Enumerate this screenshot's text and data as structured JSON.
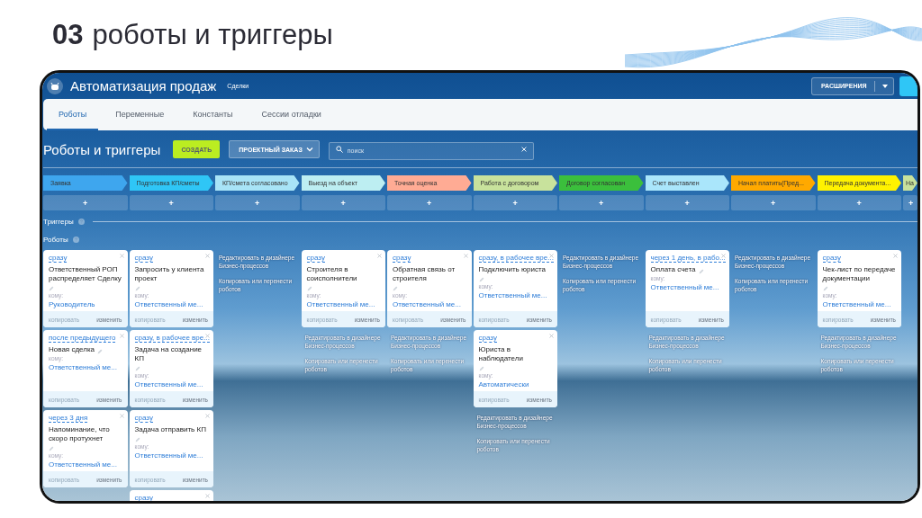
{
  "slide": {
    "number": "03",
    "title": "роботы и триггеры"
  },
  "app": {
    "title": "Автоматизация продаж",
    "subtitle": "Сделки",
    "extensions_button": "РАСШИРЕНИЯ"
  },
  "tabs": [
    {
      "label": "Роботы",
      "selected": true
    },
    {
      "label": "Переменные",
      "selected": false
    },
    {
      "label": "Константы",
      "selected": false
    },
    {
      "label": "Сессии отладки",
      "selected": false
    }
  ],
  "toolbar": {
    "heading": "Роботы и триггеры",
    "create_button": "СОЗДАТЬ",
    "category": "ПРОЕКТНЫЙ ЗАКАЗ",
    "search": {
      "placeholder": "поиск"
    }
  },
  "sections": {
    "triggers": "Триггеры",
    "robots": "Роботы"
  },
  "stages": [
    {
      "name": "Заявка",
      "color": "#3ea6ee",
      "add": "+",
      "robots": [
        {
          "delay": "сразу",
          "title": "Ответственный РОП распределяет Сделку",
          "to_label": "кому:",
          "assignee": "Руководитель",
          "copy": "копировать",
          "copy_disabled": true,
          "edit": "изменить"
        },
        {
          "delay": "после предыдущего",
          "title": "Новая сделка",
          "to_label": "кому:",
          "assignee": "Ответственный ме...",
          "copy": "копировать",
          "copy_disabled": true,
          "edit": "изменить"
        },
        {
          "delay": "через 3 дня",
          "title": "Напоминание, что скоро протухнет",
          "to_label": "кому:",
          "assignee": "Ответственный ме...",
          "copy": "копировать",
          "copy_disabled": true,
          "edit": "изменить"
        }
      ]
    },
    {
      "name": "Подготовка КП/сметы",
      "color": "#2fc6f6",
      "add": "+",
      "robots": [
        {
          "delay": "сразу",
          "title": "Запросить у клиента проект",
          "to_label": "кому:",
          "assignee": "Ответственный ме...",
          "copy": "копировать",
          "copy_disabled": true,
          "edit": "изменить"
        },
        {
          "delay": "сразу, в рабочее вре...",
          "title": "Задача на создание КП",
          "to_label": "кому:",
          "assignee": "Ответственный ме...",
          "copy": "копировать",
          "copy_disabled": true,
          "edit": "изменить"
        },
        {
          "delay": "сразу",
          "title": "Задача отправить КП",
          "to_label": "кому:",
          "assignee": "Ответственный ме...",
          "copy": "копировать",
          "copy_disabled": true,
          "edit": "изменить"
        },
        {
          "delay": "сразу"
        }
      ]
    },
    {
      "name": "КП/смета согласовано",
      "color": "#a8e4f7",
      "add": "+",
      "links": {
        "edit_link": "Редактировать в дизайнере Бизнес-процессов",
        "copy_link": "Копировать или перенести роботов"
      }
    },
    {
      "name": "Выезд на объект",
      "color": "#bdeef2",
      "add": "+",
      "robots": [
        {
          "delay": "сразу",
          "title": "Строителя в соисполнители",
          "to_label": "кому:",
          "assignee": "Ответственный ме...",
          "copy": "копировать",
          "copy_disabled": true,
          "edit": "изменить"
        }
      ],
      "links": {
        "edit_link": "Редактировать в дизайнере Бизнес-процессов",
        "copy_link": "Копировать или перенести роботов"
      }
    },
    {
      "name": "Точная оценка",
      "color": "#ffab94",
      "add": "+",
      "robots": [
        {
          "delay": "сразу",
          "title": "Обратная связь от строителя",
          "to_label": "кому:",
          "assignee": "Ответственный ме...",
          "copy": "копировать",
          "copy_disabled": true,
          "edit": "изменить"
        }
      ],
      "links": {
        "edit_link": "Редактировать в дизайнере Бизнес-процессов",
        "copy_link": "Копировать или перенести роботов"
      }
    },
    {
      "name": "Работа с договором",
      "color": "#c8e29c",
      "add": "+",
      "robots": [
        {
          "delay": "сразу, в рабочее вре...",
          "title": "Подключить юриста",
          "to_label": "кому:",
          "assignee": "Ответственный ме...",
          "copy": "копировать",
          "copy_disabled": true,
          "edit": "изменить"
        },
        {
          "delay": "сразу",
          "title": "Юриста в наблюдатели",
          "to_label": "кому:",
          "assignee": "Автоматически",
          "copy": "копировать",
          "copy_disabled": true,
          "edit": "изменить"
        }
      ],
      "links": {
        "edit_link": "Редактировать в дизайнере Бизнес-процессов",
        "copy_link": "Копировать или перенести роботов"
      }
    },
    {
      "name": "Договор согласован",
      "color": "#3bbf3c",
      "add": "+",
      "links": {
        "edit_link": "Редактировать в дизайнере Бизнес-процессов",
        "copy_link": "Копировать или перенести роботов"
      }
    },
    {
      "name": "Счет выставлен",
      "color": "#aae6fb",
      "add": "+",
      "robots": [
        {
          "delay": "через 1 день, в рабо...",
          "title": "Оплата счета",
          "to_label": "кому:",
          "assignee": "Ответственный ме...",
          "copy": "копировать",
          "copy_disabled": true,
          "edit": "изменить"
        }
      ],
      "links": {
        "edit_link": "Редактировать в дизайнере Бизнес-процессов",
        "copy_link": "Копировать или перенести роботов"
      }
    },
    {
      "name": "Начал платить(Пред...",
      "color": "#ffa900",
      "add": "+",
      "links": {
        "edit_link": "Редактировать в дизайнере Бизнес-процессов",
        "copy_link": "Копировать или перенести роботов"
      }
    },
    {
      "name": "Передача документа...",
      "color": "#fff200",
      "add": "+",
      "robots": [
        {
          "delay": "сразу",
          "title": "Чек-лист по передаче документации",
          "to_label": "кому:",
          "assignee": "Ответственный ме...",
          "copy": "копировать",
          "copy_disabled": true,
          "edit": "изменить"
        }
      ],
      "links": {
        "edit_link": "Редактировать в дизайнере Бизнес-процессов",
        "copy_link": "Копировать или перенести роботов"
      }
    },
    {
      "name": "На",
      "color": "#c8e29c",
      "add": "+"
    }
  ]
}
